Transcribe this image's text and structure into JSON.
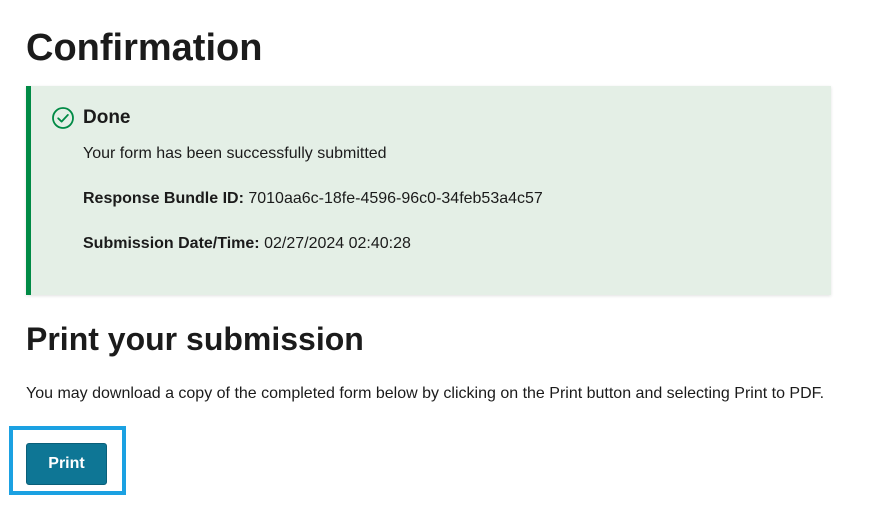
{
  "page": {
    "title": "Confirmation"
  },
  "alert": {
    "status": "success",
    "icon": "check-circle-icon",
    "accent_color": "#008a45",
    "background_color": "#e4efe6",
    "heading": "Done",
    "message": "Your form has been successfully submitted",
    "bundle_label": "Response Bundle ID:",
    "bundle_value": "7010aa6c-18fe-4596-96c0-34feb53a4c57",
    "datetime_label": "Submission Date/Time:",
    "datetime_value": "02/27/2024 02:40:28"
  },
  "print_section": {
    "heading": "Print your submission",
    "description": "You may download a copy of the completed form below by clicking on the Print button and selecting Print to PDF.",
    "button_label": "Print",
    "button_color": "#0e7695",
    "highlight_color": "#1ba1e2"
  }
}
